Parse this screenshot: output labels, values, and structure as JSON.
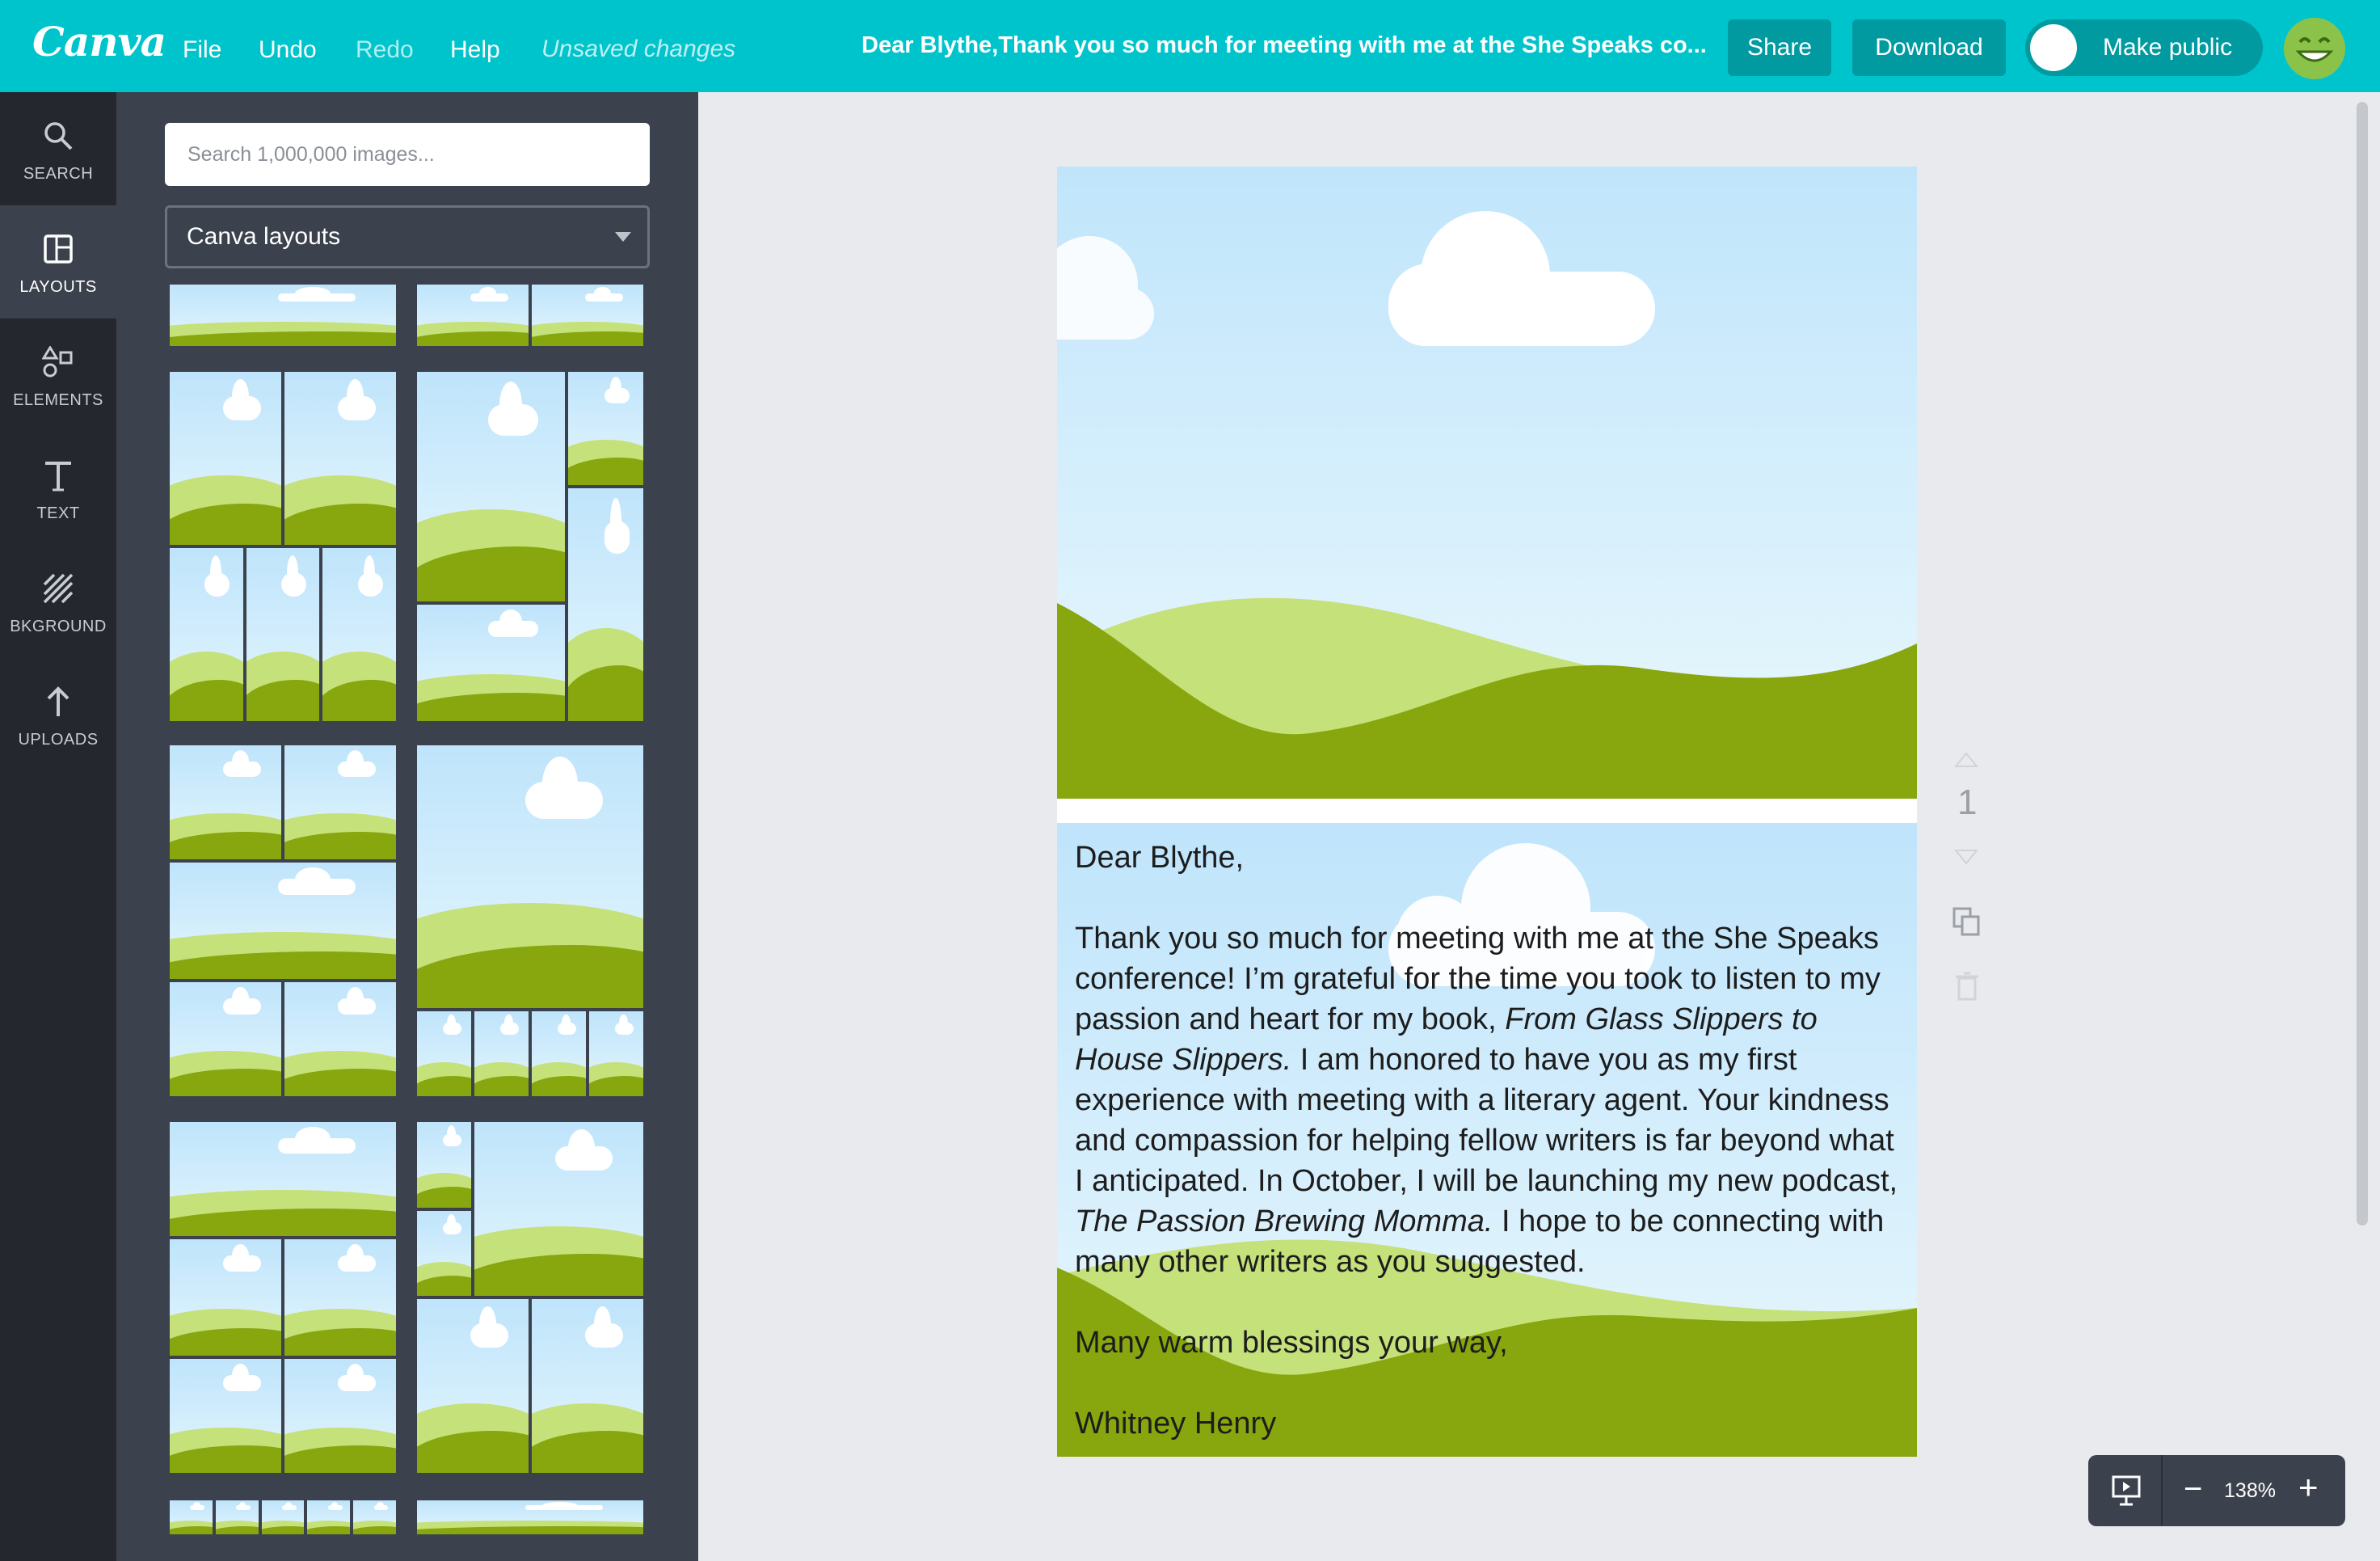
{
  "topbar": {
    "logo": "Canva",
    "menu": {
      "file": "File",
      "undo": "Undo",
      "redo": "Redo",
      "help": "Help"
    },
    "status": "Unsaved changes",
    "document_title": "Dear Blythe,Thank you so much for meeting with me at the She Speaks co...",
    "share_label": "Share",
    "download_label": "Download",
    "public_label": "Make public",
    "accent_color": "#00c4cc"
  },
  "rail": {
    "items": [
      {
        "label": "SEARCH",
        "icon": "search-icon"
      },
      {
        "label": "LAYOUTS",
        "icon": "layouts-icon",
        "active": true
      },
      {
        "label": "ELEMENTS",
        "icon": "elements-icon"
      },
      {
        "label": "TEXT",
        "icon": "text-icon"
      },
      {
        "label": "BKGROUND",
        "icon": "background-icon"
      },
      {
        "label": "UPLOADS",
        "icon": "upload-icon"
      }
    ]
  },
  "panel": {
    "search_placeholder": "Search 1,000,000 images...",
    "layout_selector": "Canva layouts"
  },
  "letter": {
    "greeting": "Dear Blythe,",
    "body_1": "Thank you so much for meeting with me at the She Speaks conference! I’m grateful for the time you took to listen to my passion and heart for my book, ",
    "book_title": "From Glass Slippers to House Slippers.",
    "body_2": " I am honored to have you as my first experience with meeting with a literary agent. Your kindness and compassion for helping fellow writers is far beyond what I anticipated. In October, I will be launching my new podcast, ",
    "podcast_title": "The Passion Brewing Momma.",
    "body_3": " I hope to be connecting with many other writers as you suggested.",
    "closing": "Many warm blessings your way,",
    "signature": "Whitney Henry"
  },
  "canvas": {
    "page_number": "1",
    "zoom": "138%"
  }
}
